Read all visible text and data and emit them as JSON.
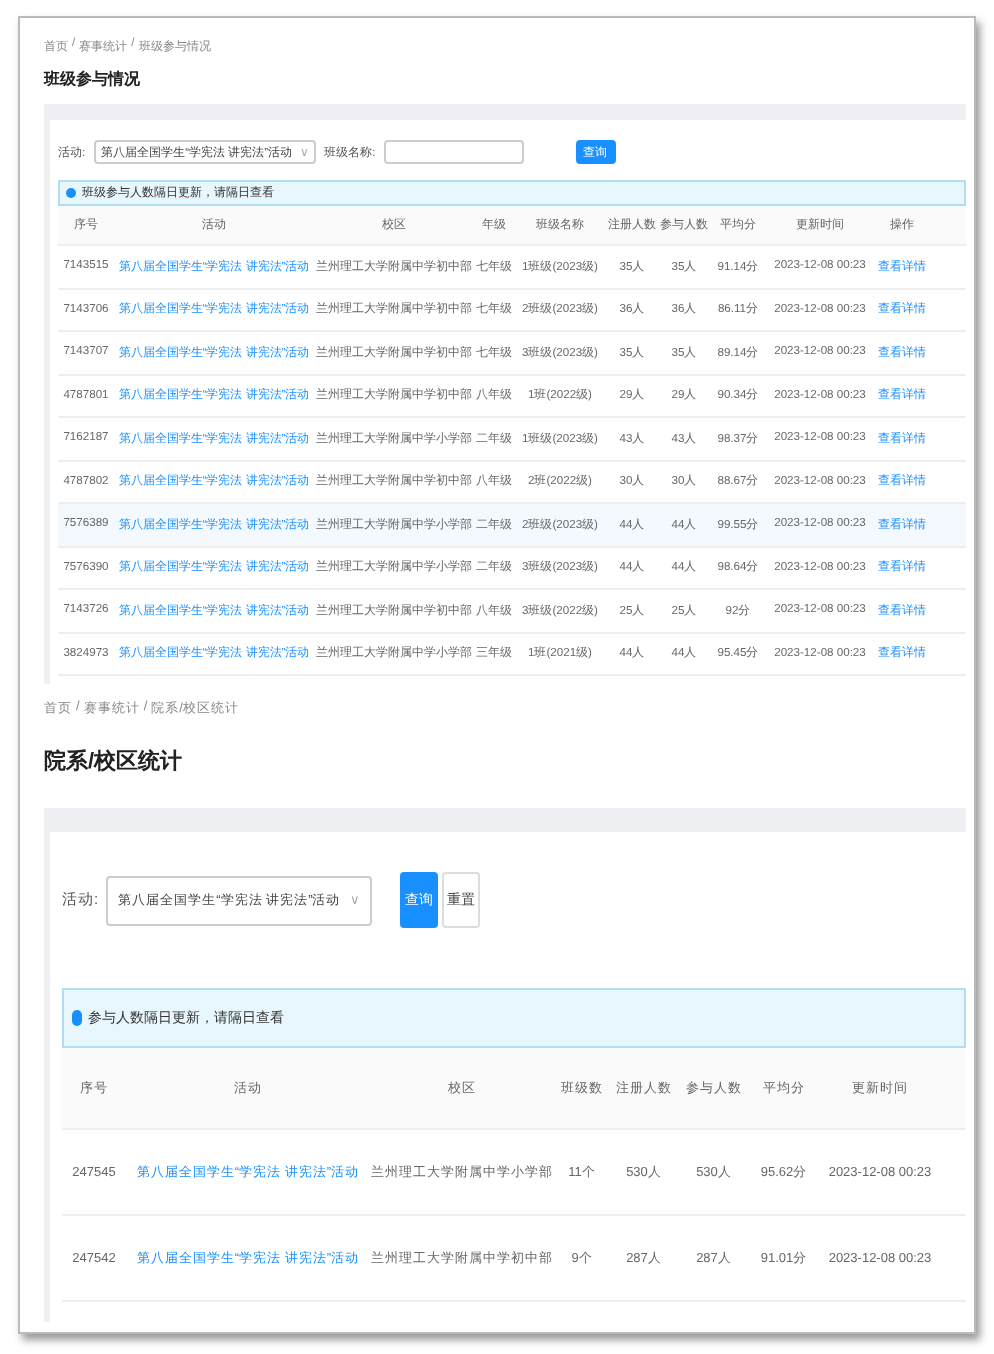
{
  "panels": [
    {
      "breadcrumb": [
        "首页",
        "赛事统计",
        "班级参与情况"
      ],
      "separator": "/",
      "title": "班级参与情况",
      "filters": [
        {
          "kind": "select",
          "label": "活动:",
          "value": "第八届全国学生“学宪法 讲宪法”活动",
          "chevron": "∨"
        },
        {
          "kind": "input",
          "label": "班级名称:"
        }
      ],
      "buttons": [
        {
          "label": "查询",
          "primary": true
        }
      ],
      "notice": "班级参与人数隔日更新，请隔日查看",
      "table": {
        "columns": [
          {
            "label": "序号",
            "kind": "text"
          },
          {
            "label": "活动",
            "kind": "link"
          },
          {
            "label": "校区",
            "kind": "text"
          },
          {
            "label": "年级",
            "kind": "text"
          },
          {
            "label": "班级名称",
            "kind": "text"
          },
          {
            "label": "注册人数",
            "kind": "text"
          },
          {
            "label": "参与人数",
            "kind": "text"
          },
          {
            "label": "平均分",
            "kind": "text"
          },
          {
            "label": "更新时间",
            "kind": "text"
          },
          {
            "label": "操作",
            "kind": "link"
          }
        ],
        "rows": [
          {
            "hovered": false,
            "cells": [
              "7143515",
              "第八届全国学生“学宪法 讲宪法”活动",
              "兰州理工大学附属中学初中部",
              "七年级",
              "1班级(2023级)",
              "35人",
              "35人",
              "91.14分",
              "2023-12-08 00:23",
              "查看详情"
            ]
          },
          {
            "hovered": false,
            "cells": [
              "7143706",
              "第八届全国学生“学宪法 讲宪法”活动",
              "兰州理工大学附属中学初中部",
              "七年级",
              "2班级(2023级)",
              "36人",
              "36人",
              "86.11分",
              "2023-12-08 00:23",
              "查看详情"
            ]
          },
          {
            "hovered": false,
            "cells": [
              "7143707",
              "第八届全国学生“学宪法 讲宪法”活动",
              "兰州理工大学附属中学初中部",
              "七年级",
              "3班级(2023级)",
              "35人",
              "35人",
              "89.14分",
              "2023-12-08 00:23",
              "查看详情"
            ]
          },
          {
            "hovered": false,
            "cells": [
              "4787801",
              "第八届全国学生“学宪法 讲宪法”活动",
              "兰州理工大学附属中学初中部",
              "八年级",
              "1班(2022级)",
              "29人",
              "29人",
              "90.34分",
              "2023-12-08 00:23",
              "查看详情"
            ]
          },
          {
            "hovered": false,
            "cells": [
              "7162187",
              "第八届全国学生“学宪法 讲宪法”活动",
              "兰州理工大学附属中学小学部",
              "二年级",
              "1班级(2023级)",
              "43人",
              "43人",
              "98.37分",
              "2023-12-08 00:23",
              "查看详情"
            ]
          },
          {
            "hovered": false,
            "cells": [
              "4787802",
              "第八届全国学生“学宪法 讲宪法”活动",
              "兰州理工大学附属中学初中部",
              "八年级",
              "2班(2022级)",
              "30人",
              "30人",
              "88.67分",
              "2023-12-08 00:23",
              "查看详情"
            ]
          },
          {
            "hovered": true,
            "cells": [
              "7576389",
              "第八届全国学生“学宪法 讲宪法”活动",
              "兰州理工大学附属中学小学部",
              "二年级",
              "2班级(2023级)",
              "44人",
              "44人",
              "99.55分",
              "2023-12-08 00:23",
              "查看详情"
            ]
          },
          {
            "hovered": false,
            "cells": [
              "7576390",
              "第八届全国学生“学宪法 讲宪法”活动",
              "兰州理工大学附属中学小学部",
              "二年级",
              "3班级(2023级)",
              "44人",
              "44人",
              "98.64分",
              "2023-12-08 00:23",
              "查看详情"
            ]
          },
          {
            "hovered": false,
            "cells": [
              "7143726",
              "第八届全国学生“学宪法 讲宪法”活动",
              "兰州理工大学附属中学初中部",
              "八年级",
              "3班级(2022级)",
              "25人",
              "25人",
              "92分",
              "2023-12-08 00:23",
              "查看详情"
            ]
          },
          {
            "hovered": false,
            "cells": [
              "3824973",
              "第八届全国学生“学宪法 讲宪法”活动",
              "兰州理工大学附属中学小学部",
              "三年级",
              "1班(2021级)",
              "44人",
              "44人",
              "95.45分",
              "2023-12-08 00:23",
              "查看详情"
            ]
          }
        ]
      }
    },
    {
      "breadcrumb": [
        "首页",
        "赛事统计",
        "院系/校区统计"
      ],
      "separator": "/",
      "title": "院系/校区统计",
      "filters": [
        {
          "kind": "select",
          "label": "活动:",
          "value": "第八届全国学生“学宪法 讲宪法”活动",
          "chevron": "∨"
        }
      ],
      "buttons": [
        {
          "label": "查询",
          "primary": true
        },
        {
          "label": "重置",
          "primary": false
        }
      ],
      "notice": "参与人数隔日更新，请隔日查看",
      "table": {
        "columns": [
          {
            "label": "序号",
            "kind": "text"
          },
          {
            "label": "活动",
            "kind": "link"
          },
          {
            "label": "校区",
            "kind": "text"
          },
          {
            "label": "班级数",
            "kind": "text"
          },
          {
            "label": "注册人数",
            "kind": "text"
          },
          {
            "label": "参与人数",
            "kind": "text"
          },
          {
            "label": "平均分",
            "kind": "text"
          },
          {
            "label": "更新时间",
            "kind": "text"
          }
        ],
        "rows": [
          {
            "hovered": false,
            "cells": [
              "247545",
              "第八届全国学生“学宪法 讲宪法”活动",
              "兰州理工大学附属中学小学部",
              "11个",
              "530人",
              "530人",
              "95.62分",
              "2023-12-08 00:23"
            ]
          },
          {
            "hovered": false,
            "cells": [
              "247542",
              "第八届全国学生“学宪法 讲宪法”活动",
              "兰州理工大学附属中学初中部",
              "9个",
              "287人",
              "287人",
              "91.01分",
              "2023-12-08 00:23"
            ]
          }
        ]
      }
    }
  ]
}
